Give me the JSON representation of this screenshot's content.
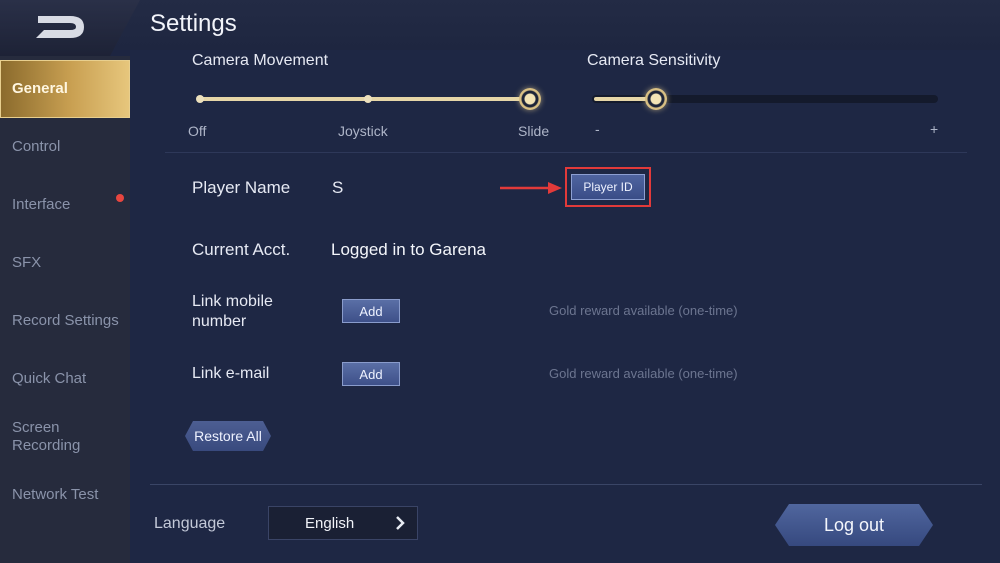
{
  "header": {
    "title": "Settings",
    "back_icon": "back-arrow-icon"
  },
  "sidebar": {
    "items": [
      {
        "label": "General",
        "active": true
      },
      {
        "label": "Control"
      },
      {
        "label": "Interface",
        "badge_dot": true
      },
      {
        "label": "SFX"
      },
      {
        "label": "Record Settings"
      },
      {
        "label": "Quick Chat"
      },
      {
        "label": "Screen Recording"
      },
      {
        "label": "Network Test"
      }
    ]
  },
  "camera_movement": {
    "label": "Camera Movement",
    "options": [
      "Off",
      "Joystick",
      "Slide"
    ],
    "selected": "Slide"
  },
  "camera_sensitivity": {
    "label": "Camera Sensitivity",
    "min_label": "-",
    "max_label": "+",
    "value_fraction": 0.18
  },
  "player_name": {
    "label": "Player Name",
    "value": "S",
    "button": "Player ID"
  },
  "current_acct": {
    "label": "Current Acct.",
    "value": "Logged in to Garena"
  },
  "link_mobile": {
    "label_line1": "Link mobile",
    "label_line2": "number",
    "button": "Add",
    "hint": "Gold reward available (one-time)"
  },
  "link_email": {
    "label": "Link e-mail",
    "button": "Add",
    "hint": "Gold reward available (one-time)"
  },
  "restore_all": "Restore All",
  "language": {
    "label": "Language",
    "value": "English"
  },
  "logout": "Log out",
  "colors": {
    "accent_gold": "#e6d6a8",
    "highlight_red": "#e23a3a",
    "background": "#1e2744"
  }
}
